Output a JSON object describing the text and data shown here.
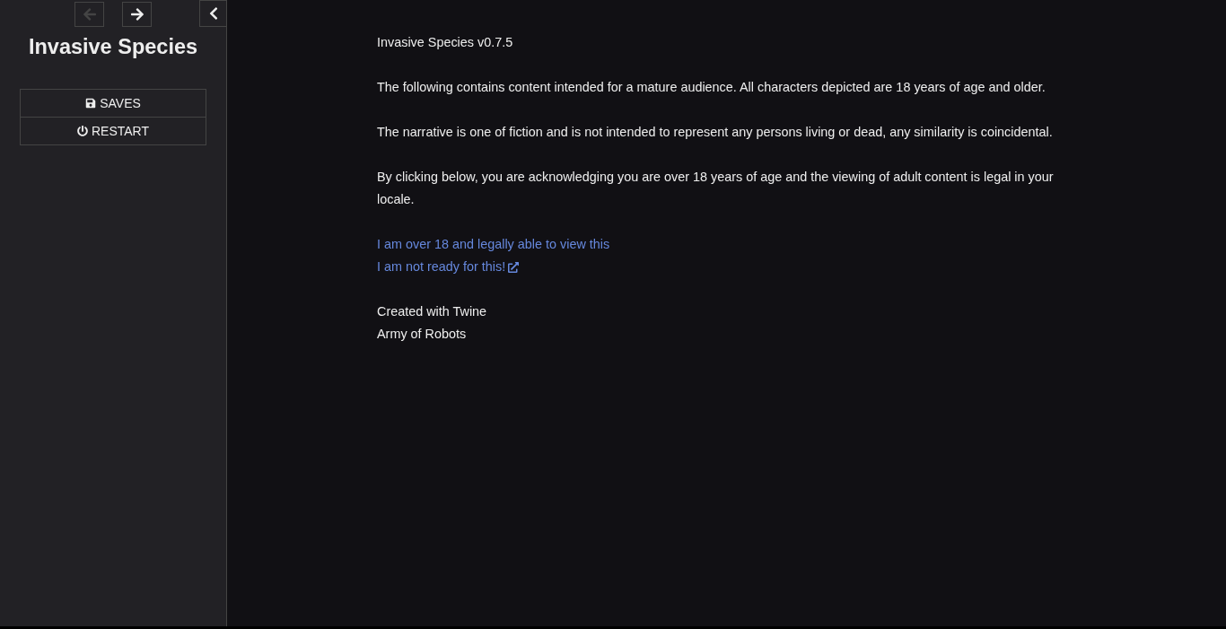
{
  "nav": {
    "back": {
      "disabled": true
    },
    "forward": {
      "disabled": false
    }
  },
  "sidebar": {
    "expanded": true,
    "title": "Invasive Species",
    "menu": [
      {
        "kind": "saves",
        "label": "SAVES"
      },
      {
        "kind": "restart",
        "label": "RESTART"
      }
    ]
  },
  "passage": {
    "version": "Invasive Species v0.7.5",
    "paragraphs": [
      "The following contains content intended for a mature audience. All characters depicted are 18 years of age and older.",
      "The narrative is one of fiction and is not intended to represent any persons living or dead, any similarity is coincidental.",
      "By clicking below, you are acknowledging you are over 18 years of age and the viewing of adult content is legal in your locale."
    ],
    "links": [
      {
        "label": "I am over 18 and legally able to view this",
        "external": false
      },
      {
        "label": "I am not ready for this!",
        "external": true
      }
    ],
    "credits": [
      "Created with Twine",
      "Army of Robots"
    ]
  }
}
